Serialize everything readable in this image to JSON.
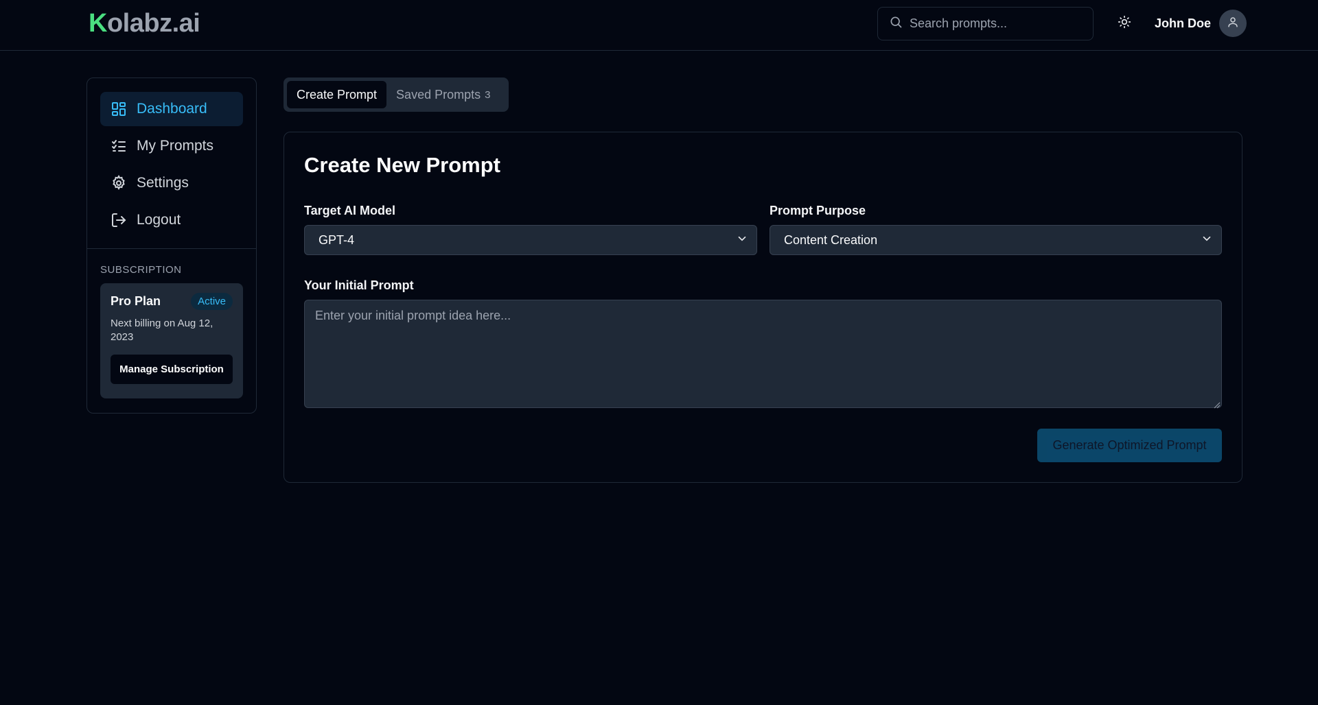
{
  "header": {
    "logo_k": "K",
    "logo_rest": "olabz.ai",
    "search_placeholder": "Search prompts...",
    "user_name": "John Doe"
  },
  "sidebar": {
    "items": [
      {
        "label": "Dashboard",
        "icon": "dashboard-icon",
        "active": true
      },
      {
        "label": "My Prompts",
        "icon": "list-checks-icon",
        "active": false
      },
      {
        "label": "Settings",
        "icon": "gear-icon",
        "active": false
      },
      {
        "label": "Logout",
        "icon": "logout-icon",
        "active": false
      }
    ],
    "subscription": {
      "title": "SUBSCRIPTION",
      "plan": "Pro Plan",
      "status": "Active",
      "billing": "Next billing on Aug 12, 2023",
      "manage_label": "Manage Subscription"
    }
  },
  "tabs": [
    {
      "label": "Create Prompt",
      "active": true
    },
    {
      "label": "Saved Prompts",
      "count": "3",
      "active": false
    }
  ],
  "main": {
    "title": "Create New Prompt",
    "model_label": "Target AI Model",
    "model_value": "GPT-4",
    "purpose_label": "Prompt Purpose",
    "purpose_value": "Content Creation",
    "prompt_label": "Your Initial Prompt",
    "prompt_placeholder": "Enter your initial prompt idea here...",
    "generate_label": "Generate Optimized Prompt"
  },
  "colors": {
    "background": "#030712",
    "accent": "#38bdf8",
    "logo_green": "#4ade80",
    "button_primary": "#0c4a6e"
  }
}
